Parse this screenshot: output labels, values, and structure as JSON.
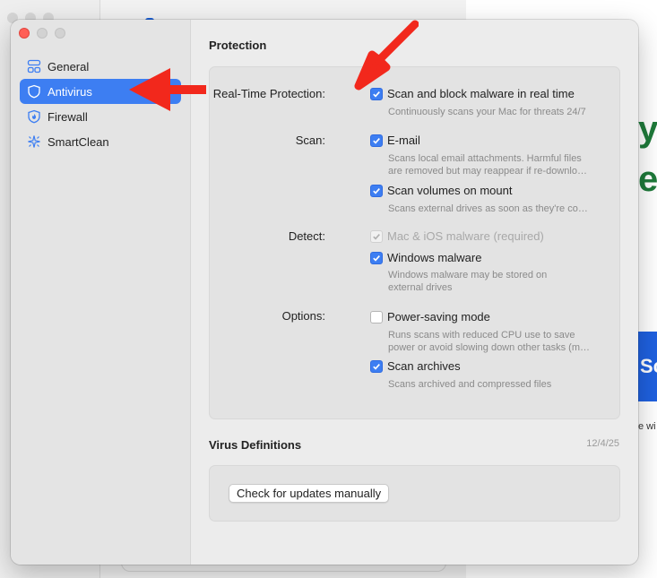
{
  "sidebar": {
    "items": [
      {
        "label": "General",
        "icon": "general-icon"
      },
      {
        "label": "Antivirus",
        "icon": "shield-icon",
        "active": true
      },
      {
        "label": "Firewall",
        "icon": "firewall-icon"
      },
      {
        "label": "SmartClean",
        "icon": "sparkle-icon"
      }
    ]
  },
  "protection": {
    "title": "Protection",
    "realtime": {
      "label": "Real-Time Protection:",
      "option": "Scan and block malware in real time",
      "desc": "Continuously scans your Mac for threats 24/7",
      "checked": true
    },
    "scan": {
      "label": "Scan:",
      "email": {
        "option": "E-mail",
        "desc1": "Scans local email attachments. Harmful files",
        "desc2": "are removed but may reappear if re-downlo…",
        "checked": true
      },
      "volumes": {
        "option": "Scan volumes on mount",
        "desc": "Scans external drives as soon as they're co…",
        "checked": true
      }
    },
    "detect": {
      "label": "Detect:",
      "mac": {
        "option": "Mac & iOS malware (required)",
        "checked": true,
        "disabled": true
      },
      "windows": {
        "option": "Windows malware",
        "desc1": "Windows malware may be stored on",
        "desc2": "external drives",
        "checked": true
      }
    },
    "options": {
      "label": "Options:",
      "power": {
        "option": "Power-saving mode",
        "desc1": "Runs scans with reduced CPU use to save",
        "desc2": "power or avoid slowing down other tasks (m…",
        "checked": false
      },
      "archives": {
        "option": "Scan archives",
        "desc": "Scans archived and compressed files",
        "checked": true
      }
    }
  },
  "definitions": {
    "title": "Virus Definitions",
    "date": "12/4/25",
    "button": "Check for updates manually"
  },
  "background": {
    "letter1": "y",
    "letter2": "e",
    "scan_fragment": "Sca",
    "text_fragment": "e wi"
  },
  "colors": {
    "accent": "#3d7ef2",
    "close": "#ff5f57",
    "annotation_arrow": "#f2281c",
    "background_green": "#1e7a3a"
  }
}
